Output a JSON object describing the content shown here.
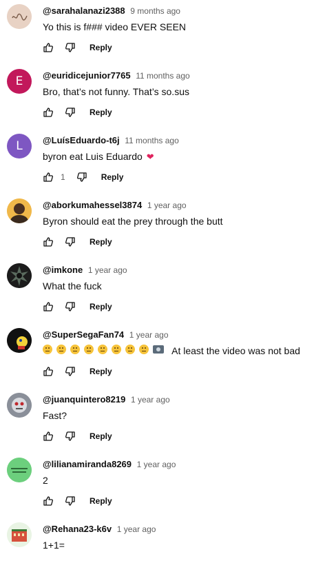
{
  "colors": {
    "author_text": "#0f0f0f",
    "meta_text": "#606060",
    "avatar_e": "#c2185b",
    "avatar_l": "#7e57c2"
  },
  "comments": [
    {
      "author": "@sarahalanazi2388",
      "time": "9 months ago",
      "text": "Yo this is f### video EVER SEEN",
      "likes": "",
      "reply": "Reply",
      "avatar": "scribble"
    },
    {
      "author": "@euridicejunior7765",
      "time": "11 months ago",
      "text": "Bro, that’s not funny. That’s so.sus",
      "likes": "",
      "reply": "Reply",
      "avatar_letter": "E"
    },
    {
      "author": "@LuísEduardo-t6j",
      "time": "11 months ago",
      "text": "byron eat Luis Eduardo",
      "heart": "❤",
      "likes": "1",
      "reply": "Reply",
      "avatar_letter": "L"
    },
    {
      "author": "@aborkumahessel3874",
      "time": "1 year ago",
      "text": "Byron should eat the prey through the butt",
      "likes": "",
      "reply": "Reply",
      "avatar": "photo-person"
    },
    {
      "author": "@imkone",
      "time": "1 year ago",
      "text": "What the fuck",
      "likes": "",
      "reply": "Reply",
      "avatar": "dark-spiky"
    },
    {
      "author": "@SuperSegaFan74",
      "time": "1 year ago",
      "text": "At least the video was not bad",
      "emoji_count": 8,
      "likes": "",
      "reply": "Reply",
      "avatar": "dark-character"
    },
    {
      "author": "@juanquintero8219",
      "time": "1 year ago",
      "text": "Fast?",
      "likes": "",
      "reply": "Reply",
      "avatar": "robot-face"
    },
    {
      "author": "@lilianamiranda8269",
      "time": "1 year ago",
      "text": "2",
      "likes": "",
      "reply": "Reply",
      "avatar": "green-logo"
    },
    {
      "author": "@Rehana23-k6v",
      "time": "1 year ago",
      "text": "1+1=",
      "likes": "",
      "reply": "Reply",
      "avatar": "building-cartoon"
    }
  ]
}
